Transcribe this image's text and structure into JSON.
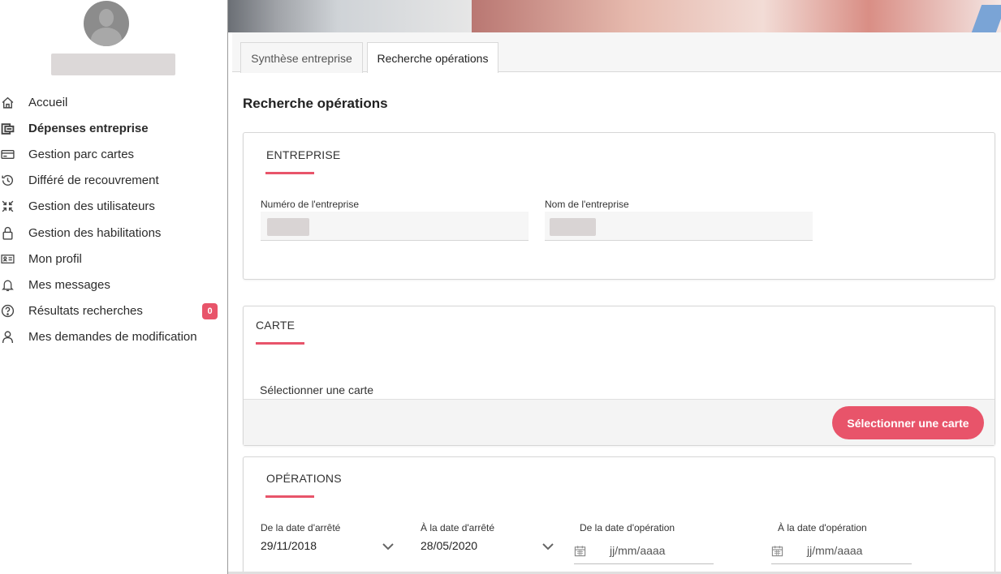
{
  "sidebar": {
    "items": [
      {
        "label": "Accueil",
        "icon": "home-icon",
        "active": false
      },
      {
        "label": "Dépenses entreprise",
        "icon": "expenses-icon",
        "active": true
      },
      {
        "label": "Gestion parc cartes",
        "icon": "credit-card-icon",
        "active": false
      },
      {
        "label": "Différé de recouvrement",
        "icon": "history-icon",
        "active": false
      },
      {
        "label": "Gestion des utilisateurs",
        "icon": "users-compress-icon",
        "active": false
      },
      {
        "label": "Gestion des habilitations",
        "icon": "lock-icon",
        "active": false
      },
      {
        "label": "Mon profil",
        "icon": "id-card-icon",
        "active": false
      },
      {
        "label": "Mes messages",
        "icon": "bell-icon",
        "active": false
      },
      {
        "label": "Résultats recherches",
        "icon": "question-circle-icon",
        "active": false,
        "badge": "0"
      },
      {
        "label": "Mes demandes de modification",
        "icon": "user-icon",
        "active": false
      }
    ],
    "badge_color": "#e8546a"
  },
  "tabs": [
    {
      "label": "Synthèse entreprise",
      "active": false
    },
    {
      "label": "Recherche opérations",
      "active": true
    }
  ],
  "page": {
    "title": "Recherche opérations"
  },
  "entreprise": {
    "title": "ENTREPRISE",
    "numero_label": "Numéro de l'entreprise",
    "nom_label": "Nom de l'entreprise"
  },
  "carte": {
    "title": "CARTE",
    "prompt": "Sélectionner une carte",
    "button": "Sélectionner une carte"
  },
  "operations": {
    "title": "OPÉRATIONS",
    "fields": [
      {
        "label": "De la date d'arrêté",
        "value": "29/11/2018"
      },
      {
        "label": "À la date d'arrêté",
        "value": "28/05/2020"
      },
      {
        "label": "De la date d'opération",
        "placeholder": "jj/mm/aaaa"
      },
      {
        "label": "À la date d'opération",
        "placeholder": "jj/mm/aaaa"
      }
    ]
  },
  "accent_color": "#e8546a"
}
